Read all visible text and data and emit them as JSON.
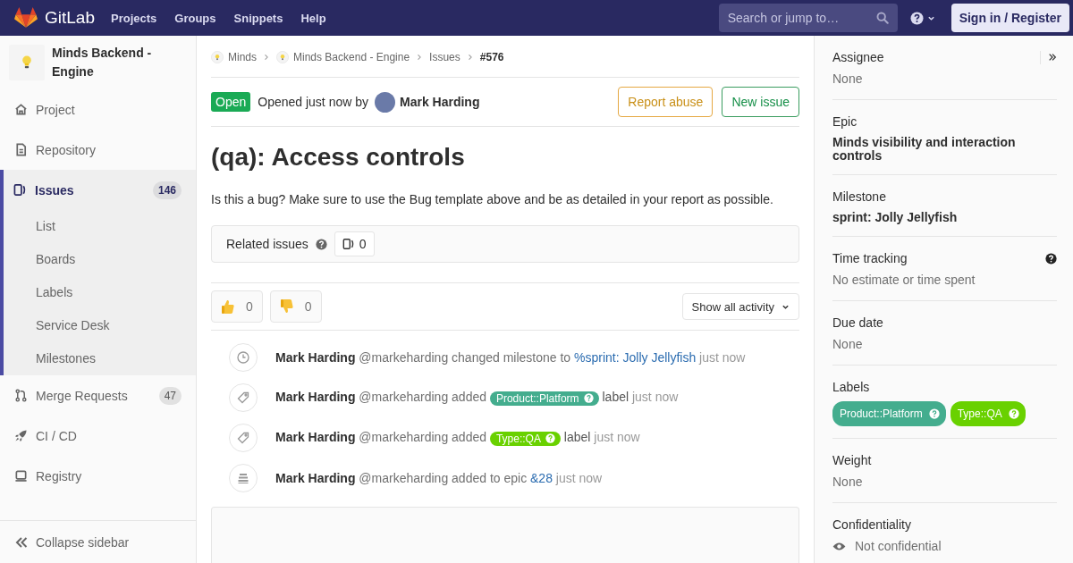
{
  "topbar": {
    "brand": "GitLab",
    "nav": [
      "Projects",
      "Groups",
      "Snippets",
      "Help"
    ],
    "search": {
      "placeholder": "Search or jump to…"
    },
    "sign_in": "Sign in / Register"
  },
  "project": {
    "name": "Minds Backend - Engine"
  },
  "nav": [
    {
      "kind": "home",
      "label": "Project",
      "selected": false
    },
    {
      "kind": "doc",
      "label": "Repository",
      "selected": false
    },
    {
      "kind": "issues",
      "label": "Issues",
      "count": "146",
      "selected": true,
      "children": [
        {
          "label": "List"
        },
        {
          "label": "Boards"
        },
        {
          "label": "Labels"
        },
        {
          "label": "Service Desk"
        },
        {
          "label": "Milestones"
        }
      ]
    },
    {
      "kind": "merge",
      "label": "Merge Requests",
      "count": "47",
      "selected": false
    },
    {
      "kind": "rocket",
      "label": "CI / CD",
      "selected": false
    },
    {
      "kind": "disk",
      "label": "Registry",
      "selected": false
    }
  ],
  "collapse": "Collapse sidebar",
  "breadcrumbs": [
    {
      "label": "Minds"
    },
    {
      "label": "Minds Backend - Engine"
    },
    {
      "label": "Issues"
    },
    {
      "label": "#576"
    }
  ],
  "issue": {
    "status": "Open",
    "opened": "Opened just now by",
    "author": "Mark Harding",
    "buttons": [
      {
        "kind": "warning",
        "label": "Report abuse"
      },
      {
        "kind": "success",
        "label": "New issue"
      }
    ],
    "title": "(qa): Access controls",
    "description": "Is this a bug? Make sure to use the Bug template above and be as detailed in your report as possible.",
    "related": {
      "label": "Related issues",
      "count": "0"
    },
    "awards": [
      {
        "kind": "thumbsup",
        "count": "0"
      },
      {
        "kind": "thumbsdown",
        "count": "0"
      }
    ],
    "activity_filter": "Show all activity"
  },
  "activity": [
    {
      "kind": "clock",
      "author": "Mark Harding",
      "handle": "@markeharding",
      "parts": [
        {
          "kind": "text",
          "text": "changed milestone to"
        },
        {
          "kind": "link",
          "text": "%sprint: Jolly Jellyfish"
        },
        {
          "kind": "time",
          "text": "just now"
        }
      ]
    },
    {
      "kind": "tag",
      "author": "Mark Harding",
      "handle": "@markeharding",
      "parts": [
        {
          "kind": "text",
          "text": "added"
        },
        {
          "kind": "label",
          "text": "Product::Platform",
          "color": "#44ad8e"
        },
        {
          "kind": "word",
          "text": "label"
        },
        {
          "kind": "time",
          "text": "just now"
        }
      ]
    },
    {
      "kind": "tag",
      "author": "Mark Harding",
      "handle": "@markeharding",
      "parts": [
        {
          "kind": "text",
          "text": "added"
        },
        {
          "kind": "label",
          "text": "Type::QA",
          "color": "#69d100"
        },
        {
          "kind": "word",
          "text": "label"
        },
        {
          "kind": "time",
          "text": "just now"
        }
      ]
    },
    {
      "kind": "epic",
      "author": "Mark Harding",
      "handle": "@markeharding",
      "parts": [
        {
          "kind": "text",
          "text": "added to epic"
        },
        {
          "kind": "link",
          "text": "&28"
        },
        {
          "kind": "time",
          "text": "just now"
        }
      ]
    }
  ],
  "sidebar": [
    {
      "kind": "muted",
      "title": "Assignee",
      "value": "None"
    },
    {
      "kind": "bold",
      "title": "Epic",
      "value": "Minds visibility and interaction controls"
    },
    {
      "kind": "bold",
      "title": "Milestone",
      "value": "sprint: Jolly Jellyfish"
    },
    {
      "kind": "muted",
      "title": "Time tracking",
      "value": "No estimate or time spent"
    },
    {
      "kind": "muted",
      "title": "Due date",
      "value": "None"
    },
    {
      "kind": "labels",
      "title": "Labels",
      "labels": [
        {
          "text": "Product::Platform",
          "color": "#44ad8e"
        },
        {
          "text": "Type::QA",
          "color": "#69d100"
        }
      ]
    },
    {
      "kind": "muted",
      "title": "Weight",
      "value": "None"
    },
    {
      "kind": "visibility",
      "title": "Confidentiality",
      "value": "Not confidential"
    }
  ]
}
